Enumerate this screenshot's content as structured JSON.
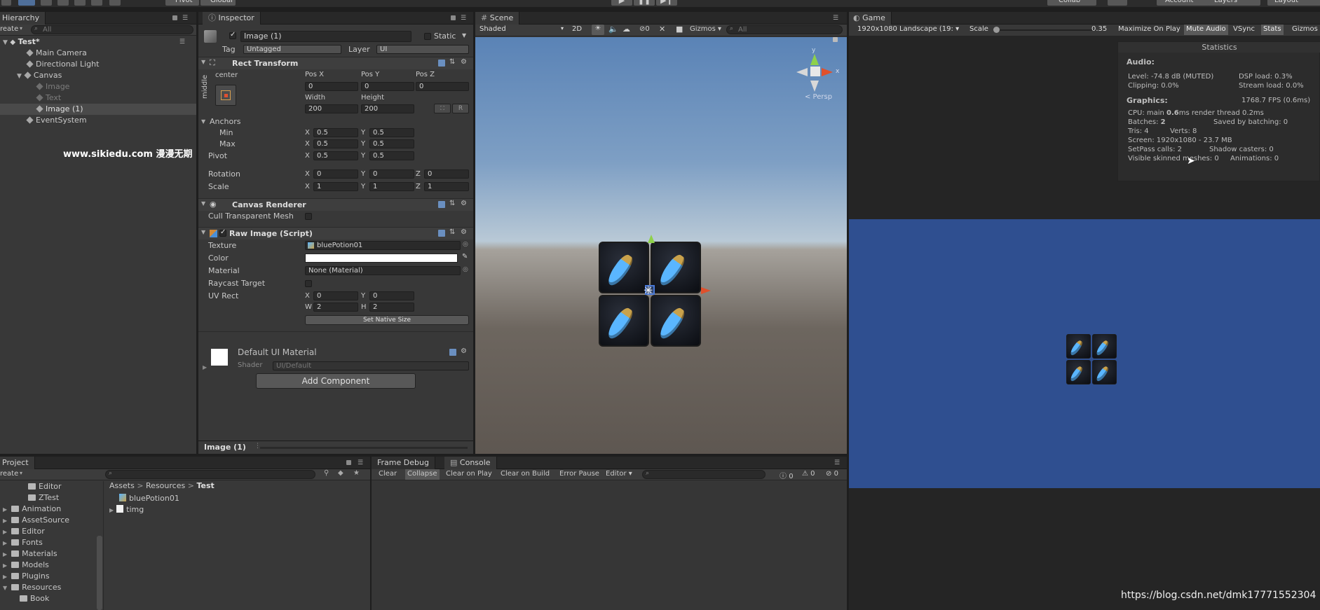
{
  "top_toolbar": {
    "pivot": "Pivot",
    "global": "Global",
    "collab": "Collab",
    "account": "Account",
    "layers": "Layers",
    "layout": "Layout"
  },
  "hierarchy": {
    "tab": "Hierarchy",
    "create": "reate",
    "search_placeholder": "All",
    "scene": "Test*",
    "items": [
      {
        "label": "Main Camera"
      },
      {
        "label": "Directional Light"
      },
      {
        "label": "Canvas"
      },
      {
        "label": "Image"
      },
      {
        "label": "Text"
      },
      {
        "label": "Image (1)"
      },
      {
        "label": "EventSystem"
      }
    ],
    "watermark": "www.sikiedu.com 漫漫无期"
  },
  "inspector": {
    "tab": "Inspector",
    "object_name": "Image (1)",
    "static_label": "Static",
    "tag_label": "Tag",
    "tag_value": "Untagged",
    "layer_label": "Layer",
    "layer_value": "UI",
    "rect_transform": {
      "title": "Rect Transform",
      "anchor_h": "center",
      "anchor_v": "middle",
      "pos_x_label": "Pos X",
      "pos_y_label": "Pos Y",
      "pos_z_label": "Pos Z",
      "pos_x": "0",
      "pos_y": "0",
      "pos_z": "0",
      "width_label": "Width",
      "height_label": "Height",
      "width": "200",
      "height": "200",
      "anchors_label": "Anchors",
      "min_label": "Min",
      "min_x": "0.5",
      "min_y": "0.5",
      "max_label": "Max",
      "max_x": "0.5",
      "max_y": "0.5",
      "pivot_label": "Pivot",
      "pivot_x": "0.5",
      "pivot_y": "0.5",
      "rotation_label": "Rotation",
      "rot_x": "0",
      "rot_y": "0",
      "rot_z": "0",
      "scale_label": "Scale",
      "scale_x": "1",
      "scale_y": "1",
      "scale_z": "1",
      "axis_x": "X",
      "axis_y": "Y",
      "axis_z": "Z"
    },
    "canvas_renderer": {
      "title": "Canvas Renderer",
      "cull_label": "Cull Transparent Mesh"
    },
    "raw_image": {
      "title": "Raw Image (Script)",
      "texture_label": "Texture",
      "texture_value": "bluePotion01",
      "color_label": "Color",
      "material_label": "Material",
      "material_value": "None (Material)",
      "raycast_label": "Raycast Target",
      "uvrect_label": "UV Rect",
      "uv_x": "0",
      "uv_y": "0",
      "uv_w": "2",
      "uv_h": "2",
      "axis_w": "W",
      "axis_h": "H",
      "native_size": "Set Native Size"
    },
    "default_material": {
      "title": "Default UI Material",
      "shader_label": "Shader",
      "shader_value": "UI/Default"
    },
    "add_component": "Add Component",
    "footer": "Image (1)"
  },
  "scene": {
    "tab": "Scene",
    "shading": "Shaded",
    "mode_2d": "2D",
    "fx_count": "0",
    "gizmos": "Gizmos",
    "search_placeholder": "All",
    "persp": "< Persp",
    "gizmo_y": "y"
  },
  "game": {
    "tab": "Game",
    "resolution": "1920x1080 Landscape (19:",
    "scale_label": "Scale",
    "scale_value": "0.35",
    "maximize": "Maximize On Play",
    "mute": "Mute Audio",
    "vsync": "VSync",
    "stats": "Stats",
    "gizmos": "Gizmos",
    "statistics": {
      "title": "Statistics",
      "audio_title": "Audio:",
      "level": "Level: -74.8 dB (MUTED)",
      "dsp": "DSP load: 0.3%",
      "clipping": "Clipping: 0.0%",
      "stream": "Stream load: 0.0%",
      "graphics_title": "Graphics:",
      "fps": "1768.7 FPS (0.6ms)",
      "cpu_prefix": "CPU: main ",
      "cpu_main": "0.6",
      "cpu_suffix": "ms  render thread 0.2ms",
      "batches_prefix": "Batches: ",
      "batches": "2",
      "saved": "Saved by batching: 0",
      "tris": "Tris: 4",
      "verts": "Verts: 8",
      "screen": "Screen: 1920x1080 - 23.7 MB",
      "setpass": "SetPass calls: 2",
      "shadow": "Shadow casters: 0",
      "skinned": "Visible skinned meshes: 0",
      "animations": "Animations: 0"
    }
  },
  "project": {
    "tab": "Project",
    "create": "reate",
    "tree": [
      {
        "label": "Editor"
      },
      {
        "label": "ZTest"
      },
      {
        "label": "Animation"
      },
      {
        "label": "AssetSource"
      },
      {
        "label": "Editor"
      },
      {
        "label": "Fonts"
      },
      {
        "label": "Materials"
      },
      {
        "label": "Models"
      },
      {
        "label": "Plugins"
      },
      {
        "label": "Resources"
      },
      {
        "label": "Book"
      }
    ],
    "breadcrumb": {
      "assets": "Assets",
      "resources": "Resources",
      "test": "Test",
      "sep": ">"
    },
    "files": [
      {
        "label": "bluePotion01"
      },
      {
        "label": "timg"
      }
    ]
  },
  "console": {
    "frame_debug": "Frame Debug",
    "tab": "Console",
    "clear": "Clear",
    "collapse": "Collapse",
    "clear_on_play": "Clear on Play",
    "clear_on_build": "Clear on Build",
    "error_pause": "Error Pause",
    "editor": "Editor",
    "info_count": "0",
    "warn_count": "0",
    "err_count": "0"
  },
  "watermark_url": "https://blog.csdn.net/dmk17771552304",
  "colors": {
    "game_bg": "#2f4f90",
    "panel": "#383838",
    "accent": "#3d6da6"
  }
}
